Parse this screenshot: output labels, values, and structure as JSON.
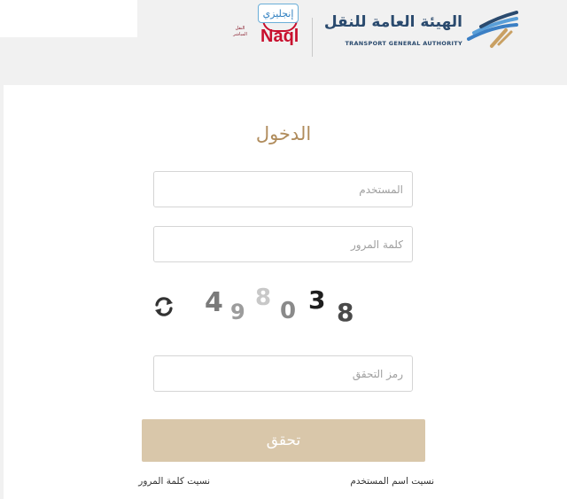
{
  "header": {
    "language_button": "إنجليزي",
    "naql_logo_text": "Naql",
    "naql_small_text": "النقل المباشر",
    "authority_name_ar": "الهيئة العامة للنقل",
    "authority_name_en": "TRANSPORT GENERAL AUTHORITY"
  },
  "login": {
    "title": "الدخول",
    "username_placeholder": "المستخدم",
    "password_placeholder": "كلمة المرور",
    "code_placeholder": "رمز التحقق",
    "submit_label": "تحقق",
    "forgot_username": "نسيت اسم المستخدم",
    "forgot_password": "نسيت كلمة المرور"
  },
  "captcha": {
    "digits": [
      "4",
      "9",
      "8",
      "0",
      "3",
      "8"
    ],
    "colors": [
      "#7a7a7a",
      "#9c9c9c",
      "#c8c8c8",
      "#8a8a8a",
      "#1e1e1e",
      "#4a4a4a"
    ]
  },
  "icons": {
    "refresh": "refresh-icon",
    "emblem": "tga-emblem-icon"
  },
  "colors": {
    "accent_gold": "#b08c5c",
    "button_bg": "#d9c7aa",
    "naql_red": "#c8102e",
    "authority_blue": "#2a4a6e"
  }
}
